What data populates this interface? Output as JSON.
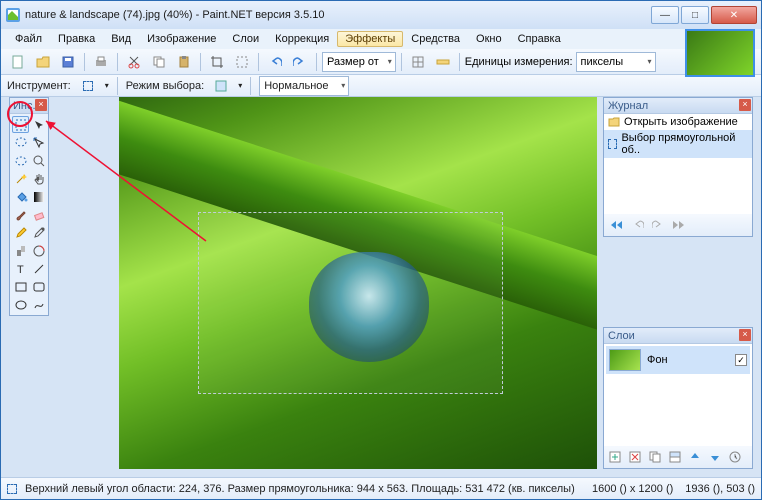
{
  "title": "nature & landscape (74).jpg (40%) - Paint.NET версия 3.5.10",
  "menu": [
    "Файл",
    "Правка",
    "Вид",
    "Изображение",
    "Слои",
    "Коррекция",
    "Эффекты",
    "Средства",
    "Окно",
    "Справка"
  ],
  "menu_active": "Эффекты",
  "toolbar1": {
    "size_label": "Размер от",
    "units_label": "Единицы измерения:",
    "units_value": "пикселы"
  },
  "toolbar2": {
    "instrument_label": "Инструмент:",
    "mode_label": "Режим выбора:",
    "mode_value": "Нормальное"
  },
  "tools_title": "Инс...",
  "tools": [
    {
      "name": "rect-select",
      "sel": true
    },
    {
      "name": "move"
    },
    {
      "name": "lasso"
    },
    {
      "name": "move-sel"
    },
    {
      "name": "ellipse-sel"
    },
    {
      "name": "zoom"
    },
    {
      "name": "magic-wand"
    },
    {
      "name": "pan"
    },
    {
      "name": "bucket"
    },
    {
      "name": "gradient"
    },
    {
      "name": "brush"
    },
    {
      "name": "eraser"
    },
    {
      "name": "pencil"
    },
    {
      "name": "picker"
    },
    {
      "name": "clone"
    },
    {
      "name": "recolor"
    },
    {
      "name": "text"
    },
    {
      "name": "line"
    },
    {
      "name": "rect"
    },
    {
      "name": "rrect"
    },
    {
      "name": "ellipse"
    },
    {
      "name": "freeform"
    }
  ],
  "history": {
    "title": "Журнал",
    "items": [
      {
        "label": "Открыть изображение",
        "icon": "open"
      },
      {
        "label": "Выбор прямоугольной об..",
        "icon": "rect"
      }
    ]
  },
  "layers": {
    "title": "Слои",
    "items": [
      {
        "label": "Фон",
        "visible": true
      }
    ]
  },
  "status": {
    "text": "Верхний левый угол области: 224, 376. Размер прямоугольника: 944 x 563. Площадь: 531 472 (кв. пикселы)",
    "imgsize": "1600 () x 1200 ()",
    "cursor": "1936 (), 503 ()"
  }
}
